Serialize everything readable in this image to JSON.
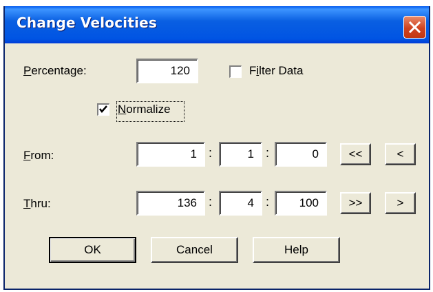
{
  "window": {
    "title": "Change Velocities"
  },
  "percentage": {
    "label_u": "P",
    "label_rest": "ercentage:",
    "value": "120"
  },
  "filter_data": {
    "label_pre": "F",
    "label_u": "i",
    "label_rest": "lter Data",
    "checked": false
  },
  "normalize": {
    "label_u": "N",
    "label_rest": "ormalize",
    "checked": true
  },
  "from": {
    "label_u": "F",
    "label_rest": "rom:",
    "bar": "1",
    "beat": "1",
    "tick": "0",
    "first_label": "<<",
    "prev_label": "<"
  },
  "thru": {
    "label_u": "T",
    "label_rest": "hru:",
    "bar": "136",
    "beat": "4",
    "tick": "100",
    "last_label": ">>",
    "next_label": ">"
  },
  "separator": ":",
  "buttons": {
    "ok": "OK",
    "cancel": "Cancel",
    "help": "Help"
  },
  "icons": {
    "close": "close-icon",
    "check": "checkmark-icon"
  },
  "colors": {
    "titlebar": "#0054e3",
    "close": "#d04320",
    "face": "#ece9d8"
  }
}
